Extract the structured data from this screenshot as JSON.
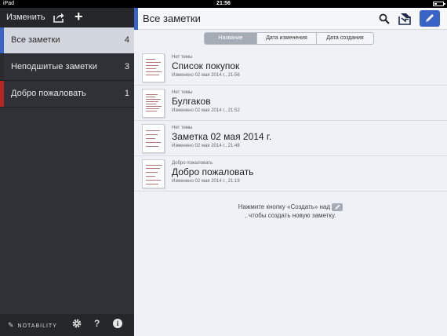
{
  "status_bar": {
    "carrier": "iPad",
    "time": "21:56",
    "battery_level": 0.3
  },
  "sidebar": {
    "edit_label": "Изменить",
    "share_icon": "share-icon",
    "add_icon": "plus-icon",
    "add_glyph": "+",
    "items": [
      {
        "label": "Все заметки",
        "count": "4",
        "color": "#3a63c8"
      },
      {
        "label": "Неподшитые заметки",
        "count": "3",
        "color": "#2a2b2f"
      },
      {
        "label": "Добро пожаловать",
        "count": "1",
        "color": "#b62424"
      }
    ],
    "footer": {
      "brand": "NOTABILITY",
      "help_glyph": "?",
      "info_glyph": "i"
    }
  },
  "main": {
    "title": "Все заметки",
    "accent_color": "#3a63c8",
    "sort_tabs": [
      "Название",
      "Дата изменения",
      "Дата создания"
    ],
    "selected_sort": "Название",
    "notes": [
      {
        "subject": "Нет темы",
        "name": "Список покупок",
        "modified": "Изменено 02 мая 2014 г., 21:56"
      },
      {
        "subject": "Нет темы",
        "name": "Булгаков",
        "modified": "Изменено 02 мая 2014 г., 21:52"
      },
      {
        "subject": "Нет темы",
        "name": "Заметка 02 мая 2014 г.",
        "modified": "Изменено 02 мая 2014 г., 21:48"
      },
      {
        "subject": "Добро пожаловать",
        "name": "Добро пожаловать",
        "modified": "Изменено 02 мая 2014 г., 21:19"
      }
    ],
    "hint_line1": "Нажмите кнопку «Создать» над",
    "hint_line2": ", чтобы создать новую заметку."
  }
}
